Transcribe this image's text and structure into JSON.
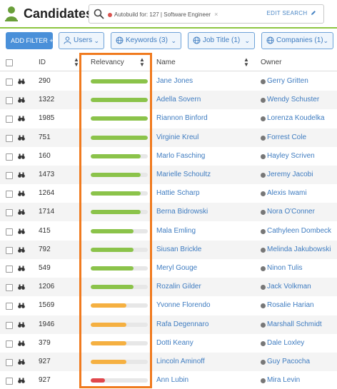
{
  "header": {
    "title": "Candidates",
    "search_chip": "Autobuild for: 127 | Software Engineer",
    "search_chip_remove": "×",
    "edit_search": "EDIT SEARCH",
    "accent_color": "#8cc540"
  },
  "filters": {
    "add_filter": "ADD FILTER +",
    "users": "Users",
    "keywords": "Keywords (3)",
    "job_title": "Job Title (1)",
    "companies": "Companies (1)"
  },
  "columns": {
    "id": "ID",
    "relevancy": "Relevancy",
    "name": "Name",
    "owner": "Owner"
  },
  "status_colors": {
    "high": "#8bc34a",
    "medium": "#f5b041",
    "low": "#e0474c"
  },
  "rows": [
    {
      "id": "290",
      "name": "Jane Jones",
      "owner": "Gerry Gritten",
      "relevancy": 1.0,
      "level": "high"
    },
    {
      "id": "1322",
      "name": "Adella Sovern",
      "owner": "Wendy Schuster",
      "relevancy": 1.0,
      "level": "high"
    },
    {
      "id": "1985",
      "name": "Riannon Binford",
      "owner": "Lorenza Koudelka",
      "relevancy": 1.0,
      "level": "high"
    },
    {
      "id": "751",
      "name": "Virginie Kreul",
      "owner": "Forrest Cole",
      "relevancy": 1.0,
      "level": "high"
    },
    {
      "id": "160",
      "name": "Marlo Fasching",
      "owner": "Hayley Scriven",
      "relevancy": 0.88,
      "level": "high"
    },
    {
      "id": "1473",
      "name": "Marielle Schoultz",
      "owner": "Jeremy Jacobi",
      "relevancy": 0.88,
      "level": "high"
    },
    {
      "id": "1264",
      "name": "Hattie Scharp",
      "owner": "Alexis Iwami",
      "relevancy": 0.88,
      "level": "high"
    },
    {
      "id": "1714",
      "name": "Berna Bidrowski",
      "owner": "Nora O'Conner",
      "relevancy": 0.88,
      "level": "high"
    },
    {
      "id": "415",
      "name": "Mala Emling",
      "owner": "Cathyleen Dombeck",
      "relevancy": 0.75,
      "level": "high"
    },
    {
      "id": "792",
      "name": "Siusan Brickle",
      "owner": "Melinda Jakubowski",
      "relevancy": 0.75,
      "level": "high"
    },
    {
      "id": "549",
      "name": "Meryl Gouge",
      "owner": "Ninon Tulis",
      "relevancy": 0.75,
      "level": "high"
    },
    {
      "id": "1206",
      "name": "Rozalin Gilder",
      "owner": "Jack Volkman",
      "relevancy": 0.75,
      "level": "high"
    },
    {
      "id": "1569",
      "name": "Yvonne Florendo",
      "owner": "Rosalie Harian",
      "relevancy": 0.62,
      "level": "medium"
    },
    {
      "id": "1946",
      "name": "Rafa Degennaro",
      "owner": "Marshall Schmidt",
      "relevancy": 0.62,
      "level": "medium"
    },
    {
      "id": "379",
      "name": "Dotti Keany",
      "owner": "Dale Loxley",
      "relevancy": 0.62,
      "level": "medium"
    },
    {
      "id": "927",
      "name": "Lincoln Aminoff",
      "owner": "Guy Pacocha",
      "relevancy": 0.62,
      "level": "medium"
    },
    {
      "id": "927",
      "name": "Ann Lubin",
      "owner": "Mira Levin",
      "relevancy": 0.25,
      "level": "low"
    }
  ]
}
